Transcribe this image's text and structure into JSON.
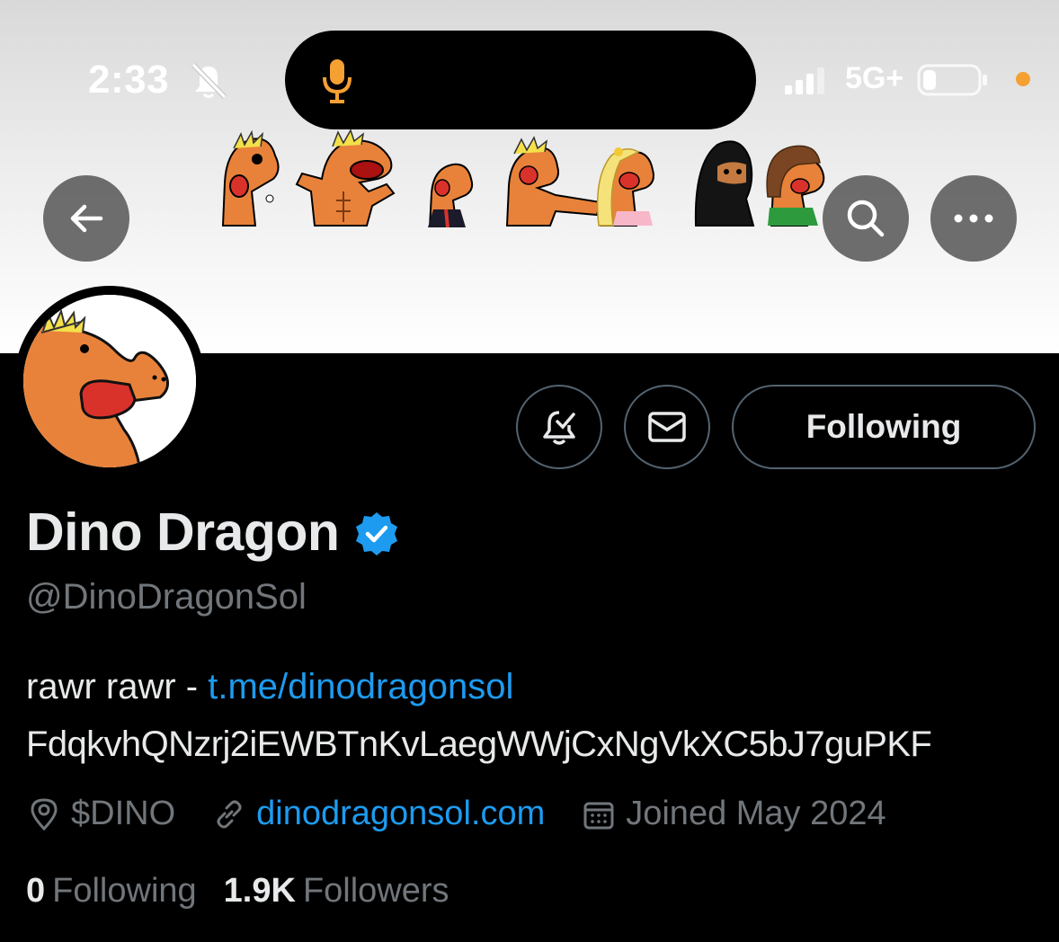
{
  "status_bar": {
    "time": "2:33",
    "network": "5G+",
    "icons": [
      "bell-slash-icon",
      "microphone-icon",
      "signal-icon",
      "battery-icon",
      "privacy-indicator-dot"
    ]
  },
  "header": {
    "buttons": [
      "back-arrow-icon",
      "search-icon",
      "more-dots-icon"
    ]
  },
  "profile": {
    "name": "Dino Dragon",
    "handle": "@DinoDragonSol",
    "verified": true,
    "bio": {
      "text": "rawr rawr - ",
      "link": "t.me/dinodragonsol",
      "line2": "FdqkvhQNzrj2iEWBTnKvLaegWWjCxNgVkXC5bJ7guPKF"
    },
    "location": "$DINO",
    "website": "dinodragonsol.com",
    "joined": "Joined May 2024",
    "following_count": "0",
    "following_label": "Following",
    "followers_count": "1.9K",
    "followers_label": "Followers"
  },
  "actions": {
    "following_button": "Following",
    "icons": [
      "bell-check-icon",
      "envelope-icon"
    ]
  },
  "colors": {
    "accent_blue": "#1d9bf0",
    "muted_gray": "#71767b",
    "dino_orange": "#e8823a",
    "mic_orange": "#f5a033"
  }
}
